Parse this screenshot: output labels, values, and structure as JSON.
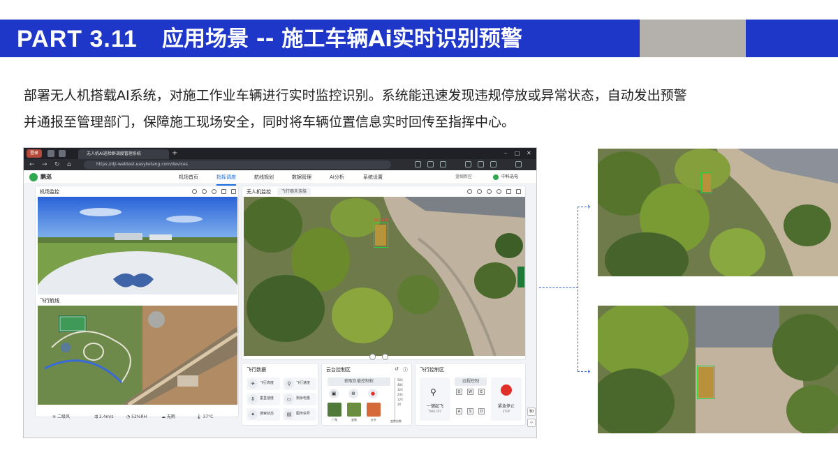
{
  "header": {
    "part": "PART 3.11",
    "title": "应用场景 -- 施工车辆Ai实时识别预警",
    "colors": {
      "primary": "#1f37c8",
      "gray_block": "#b4b0ac"
    }
  },
  "description": {
    "line1": "部署无人机搭载AI系统，对施工作业车辆进行实时监控识别。系统能迅速发现违规停放或异常状态，自动发出预警",
    "line2": "并通报至管理部门，保障施工现场安全，同时将车辆位置信息实时回传至指挥中心。"
  },
  "browser": {
    "tab_label": "无人机AI巡检群调度管理系统",
    "url": "https://dji-webtest.easyketang.com/devices",
    "account_badge": "登录"
  },
  "app": {
    "logo": "鹏巡",
    "nav": [
      "机场首页",
      "指挥调度",
      "航线规划",
      "数据管理",
      "Ai分析",
      "系统设置"
    ],
    "active_nav": "指挥调度",
    "region": "蓝绸新区",
    "user": "中科选电"
  },
  "left_panel": {
    "title": "机场监控",
    "route_title": "飞行航线",
    "weather": [
      {
        "icon": "wind-icon",
        "text": "二级风"
      },
      {
        "icon": "speed-icon",
        "text": "2.4m/s"
      },
      {
        "icon": "humidity-icon",
        "text": "52%RH"
      },
      {
        "icon": "rain-icon",
        "text": "无雨"
      },
      {
        "icon": "temperature-icon",
        "text": "37°C"
      }
    ]
  },
  "center_panel": {
    "title": "无人机监控",
    "status": "飞行器未连接",
    "detection_label": "施工车辆"
  },
  "flight_data": {
    "title": "飞行数据",
    "items": [
      "飞行高度",
      "飞行速度",
      "垂直速度",
      "剩余电量",
      "搜索状态",
      "图传信号"
    ]
  },
  "gimbal": {
    "title": "云台控制区",
    "get_control": "获取负载控制权",
    "zoom_levels": [
      "56X",
      "48X",
      "32X",
      "24X",
      "12X",
      "2X"
    ],
    "zoom_caption": "变焦倍数",
    "modes": [
      "广角",
      "变焦",
      "红外"
    ]
  },
  "flight_control": {
    "title": "飞行控制区",
    "remote": "远程控制",
    "takeoff": "一键起飞",
    "takeoff_en": "TAKE OFF",
    "stop": "紧急停止",
    "stop_en": "STOP",
    "keys_top": [
      "Q",
      "W",
      "E"
    ],
    "keys_bottom": [
      "A",
      "S",
      "D"
    ]
  },
  "view_toggle": "3D"
}
